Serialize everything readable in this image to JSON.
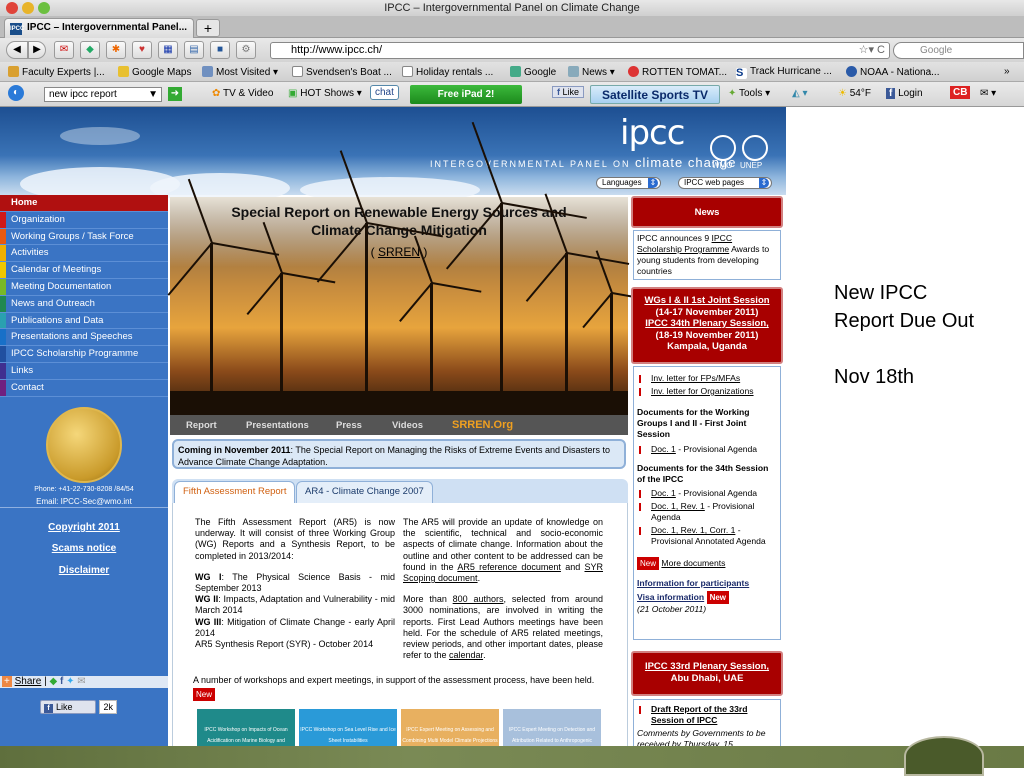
{
  "window": {
    "title": "IPCC – Intergovernmental Panel on Climate Change"
  },
  "tabs": [
    {
      "label": "IPCC – Intergovernmental Panel..."
    }
  ],
  "navbar": {
    "url": "http://www.ipcc.ch/",
    "search_placeholder": "Google"
  },
  "bookmarks": [
    "Faculty Experts |...",
    "Google Maps",
    "Most Visited ▾",
    "Svendsen's Boat ...",
    "Holiday rentals ...",
    "Google",
    "News ▾",
    "ROTTEN TOMAT...",
    "Track Hurricane ...",
    "NOAA - Nationa...",
    "»"
  ],
  "toolbar2": {
    "search_value": "new ipcc report",
    "tv_video": "TV & Video",
    "hot_shows": "HOT Shows ▾",
    "chat": "chat",
    "ipad": "Free iPad 2!",
    "like": "Like",
    "satellite": "Satellite Sports TV",
    "tools": "Tools ▾",
    "temp": "54°F",
    "login": "Login",
    "cb": "CB"
  },
  "banner": {
    "logo": "ipcc",
    "tagline_prefix": "INTERGOVERNMENTAL PANEL ON",
    "tagline_main": "climate change",
    "org1": "WMO",
    "org2": "UNEP",
    "languages": "Languages",
    "web_pages": "IPCC web pages"
  },
  "leftnav": {
    "items": [
      {
        "label": "Home",
        "color": "#b01010"
      },
      {
        "label": "Organization",
        "color": "#d01818"
      },
      {
        "label": "Working Groups / Task Force",
        "color": "#e85a10"
      },
      {
        "label": "Activities",
        "color": "#f0b000"
      },
      {
        "label": "Calendar of Meetings",
        "color": "#f0c800"
      },
      {
        "label": "Meeting Documentation",
        "color": "#78b828"
      },
      {
        "label": "News and Outreach",
        "color": "#208850"
      },
      {
        "label": "Publications and Data",
        "color": "#2aa0b0"
      },
      {
        "label": "Presentations and Speeches",
        "color": "#1870c8"
      },
      {
        "label": "IPCC Scholarship Programme",
        "color": "#2050a0"
      },
      {
        "label": "Links",
        "color": "#403090"
      },
      {
        "label": "Contact",
        "color": "#702080"
      }
    ],
    "phone": "Phone: +41-22-730-8208 /84/54",
    "email": "Email: IPCC-Sec@wmo.int",
    "copyright": "Copyright 2011",
    "scams": "Scams notice",
    "disclaimer": "Disclaimer",
    "share": "Share",
    "like_label": "Like",
    "like_count": "2k"
  },
  "hero": {
    "title_line1": "Special Report on Renewable Energy Sources and",
    "title_line2": "Climate Change Mitigation",
    "srren": "SRREN",
    "tabs": [
      "Report",
      "Presentations",
      "Press",
      "Videos",
      "SRREN.Org"
    ]
  },
  "coming": {
    "bold": "Coming in November 2011",
    "text": ": The Special Report on Managing the Risks of Extreme Events and Disasters to Advance Climate Change Adaptation."
  },
  "ar5": {
    "tab_active": "Fifth Assessment Report",
    "tab_other": "AR4 - Climate Change 2007",
    "col1_intro": "The Fifth Assessment Report (AR5) is now underway. It will consist of three Working Group (WG) Reports and a Synthesis Report, to be completed in 2013/2014:",
    "wg1_bold": "WG I",
    "wg1": ": The Physical Science Basis - mid September 2013",
    "wg2_bold": "WG II",
    "wg2": ": Impacts, Adaptation and Vulnerability - mid March 2014",
    "wg3_bold": "WG III",
    "wg3": ": Mitigation of Climate Change - early April 2014",
    "syr": "AR5 Synthesis Report (SYR) - October 2014",
    "col2_p1a": "The AR5 will provide an update of knowledge on the scientific, technical and socio-economic aspects of climate change. Information about the outline and other content to be addressed can be found in the ",
    "col2_link1": "AR5 reference document",
    "col2_p1b": " and ",
    "col2_link2": "SYR Scoping document",
    "col2_p2a": "More than ",
    "col2_link3": "800 authors",
    "col2_p2b": ", selected from around 3000 nominations, are involved in writing the reports. First Lead Authors meetings have been held. For the schedule of AR5 related meetings, review periods, and other important dates, please refer to the ",
    "col2_link4": "calendar",
    "workshops": "A number of workshops and expert meetings, in support of the assessment process, have been held.",
    "new": "New",
    "thumb1": "IPCC Workshop on Impacts of Ocean Acidification on Marine Biology and Ecosystems",
    "thumb2": "IPCC Workshop on Sea Level Rise and Ice Sheet Instabilities",
    "thumb3": "IPCC Expert Meeting on Assessing and Combining Multi Model Climate Projections",
    "thumb4": "IPCC Expert Meeting on Detection and Attribution Related to Anthropogenic Climate Change"
  },
  "news": {
    "header": "News",
    "item1a": "IPCC announces 9 ",
    "item1_link": "IPCC Scholarship Programme",
    "item1b": " Awards to young students from developing countries",
    "event1_line1": "WGs I & II 1st Joint Session",
    "event1_line2": "(14-17 November 2011)",
    "event1_line3": "IPCC 34th Plenary Session,",
    "event1_line4": "(18-19 November 2011)",
    "event1_line5": "Kampala, Uganda",
    "inv1": "Inv. letter for FPs/MFAs",
    "inv2": "Inv. letter for Organizations",
    "docs_wg_head": "Documents for the Working Groups I and II - First Joint Session",
    "doc1_link": "Doc. 1",
    "doc1_text": " - Provisional Agenda",
    "docs_34_head": "Documents for the 34th Session of the IPCC",
    "doc2_link": "Doc. 1",
    "doc2_text": " - Provisional Agenda",
    "doc3_link": "Doc. 1, Rev. 1",
    "doc3_text": " - Provisional Agenda",
    "doc4_link": "Doc. 1, Rev. 1, Corr. 1",
    "doc4_text": " - Provisional Annotated Agenda",
    "new": "New",
    "more_docs": "More documents",
    "info_participants": "Information for participants",
    "visa": "Visa information",
    "date_note": "(21 October 2011)",
    "event2_line1": "IPCC 33rd Plenary Session,",
    "event2_line2": "Abu Dhabi, UAE",
    "draft_link": "Draft Report of the 33rd Session of IPCC",
    "draft_note": "Comments by Governments to be received by Thursday, 15"
  },
  "slide": {
    "line1": "New IPCC",
    "line2": "Report Due Out",
    "line3": "Nov 18th"
  }
}
